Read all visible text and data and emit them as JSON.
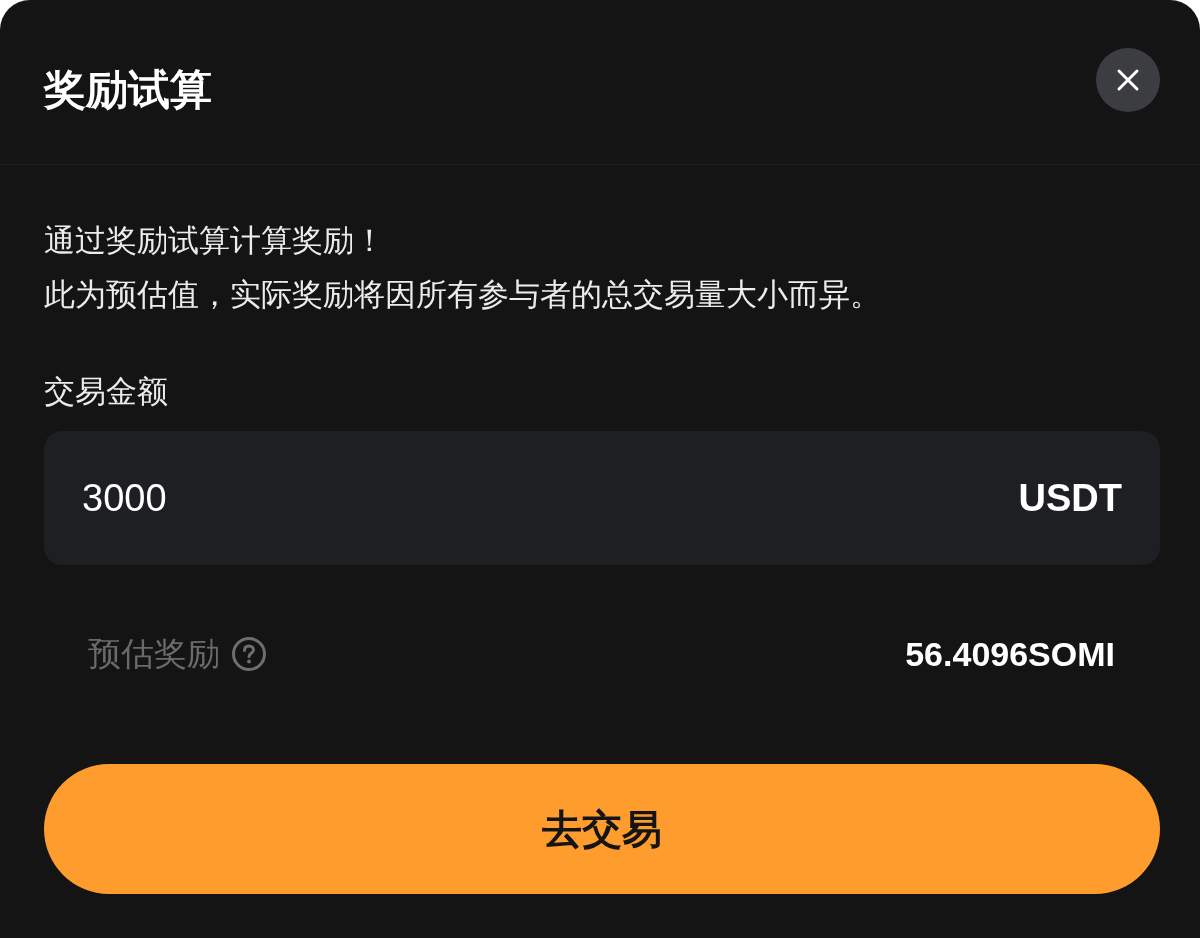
{
  "sheet": {
    "title": "奖励试算"
  },
  "description": {
    "lines": [
      "通过奖励试算计算奖励！",
      "此为预估值，实际奖励将因所有参与者的总交易量大小而异。"
    ]
  },
  "amount_field": {
    "label": "交易金额",
    "value": "3000",
    "unit": "USDT"
  },
  "estimate": {
    "label": "预估奖励",
    "value": "56.4096SOMI"
  },
  "primary_button": {
    "label": "去交易"
  }
}
